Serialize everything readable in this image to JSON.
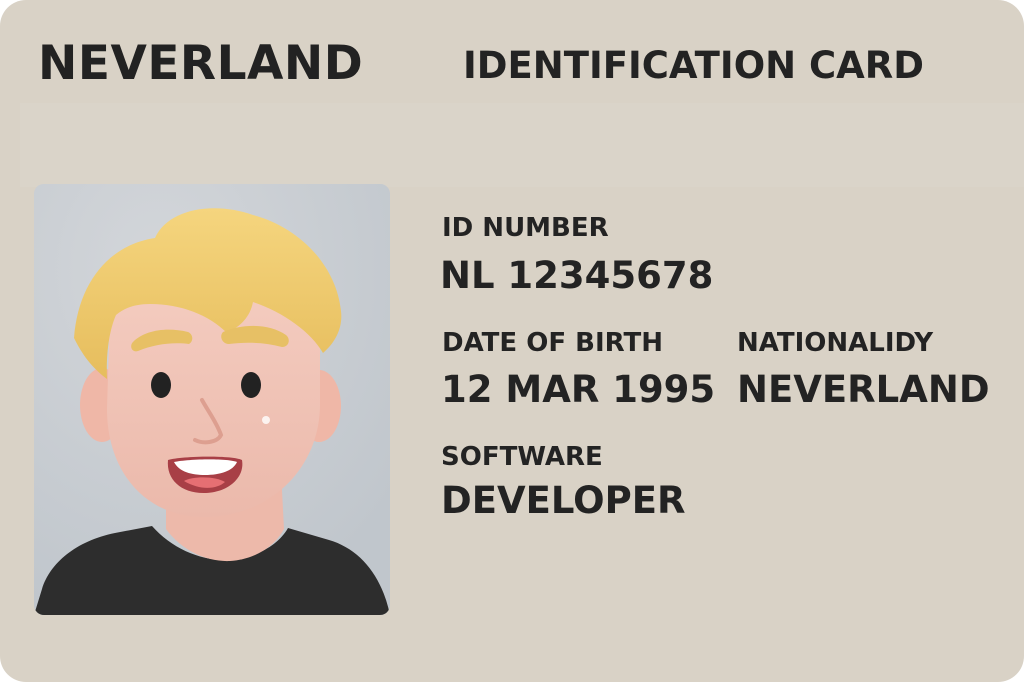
{
  "card": {
    "country": "NEVERLAND",
    "title": "IDENTIFICATION CARD"
  },
  "fields": {
    "id_number": {
      "label": "ID NUMBER",
      "value": "NL 12345678"
    },
    "date_of_birth": {
      "label": "DATE OF BIRTH",
      "value": "12 MAR 1995"
    },
    "nationality": {
      "label": "NATIONALIDY",
      "value": "NEVERLAND"
    },
    "occupation": {
      "label": "SOFTWARE",
      "value": "DEVELOPER"
    }
  },
  "photo": {
    "icon": "portrait-avatar",
    "background_color": "#c9ced3",
    "hair_color": "#efc96a",
    "skin_color": "#f0c4b8",
    "shirt_color": "#2d2d2d"
  },
  "colors": {
    "card_background": "#d9d2c6",
    "text": "#232323"
  }
}
